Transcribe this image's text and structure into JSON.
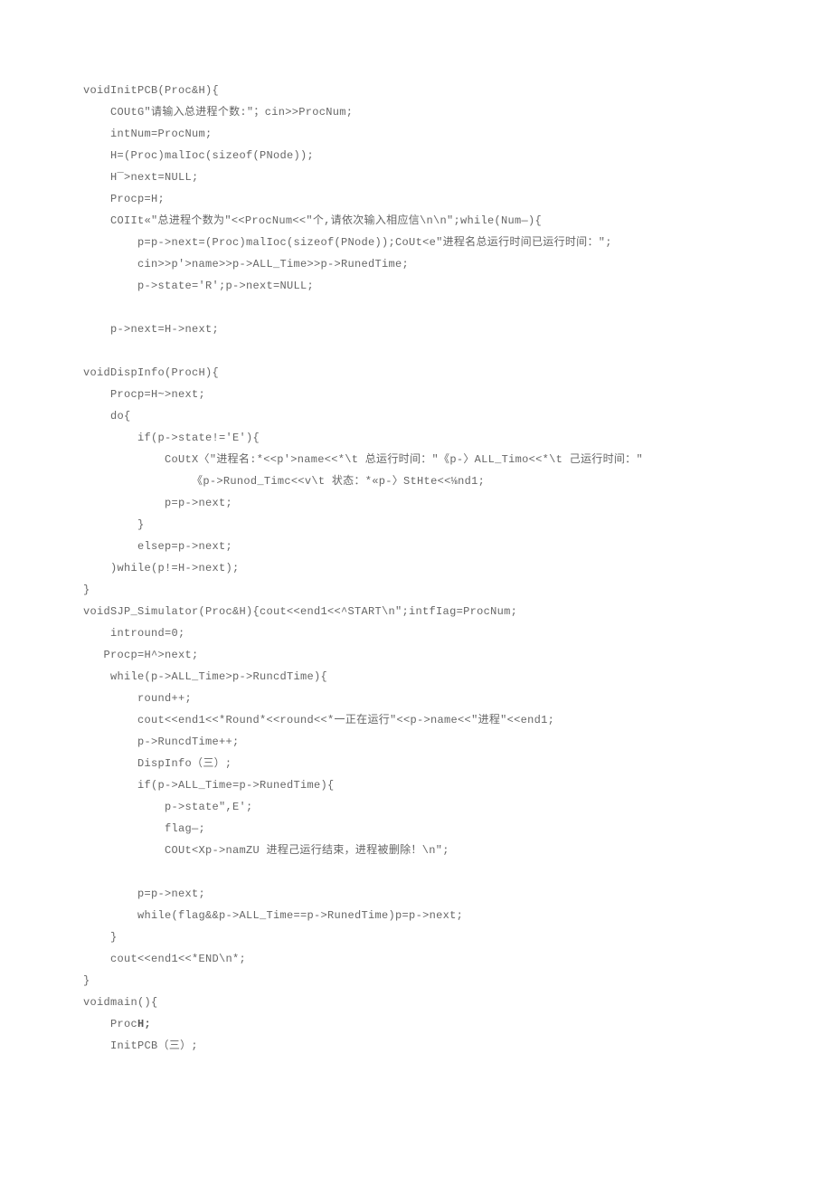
{
  "code": {
    "l1": "voidInitPCB(Proc&H){",
    "l2": "    COUtG″请输入总进程个数:″；cin>>ProcNum;",
    "l3": "    intNum=ProcNum;",
    "l4": "    H=(Proc)malIoc(sizeof(PNode));",
    "l5": "    H‾>next=NULL;",
    "l6": "    Procp=H;",
    "l7": "    COIIt«″总进程个数为″<<ProcNum<<″个,请依次输入相应信\\n\\n″;while(Num—){",
    "l8": "        p=p->next=(Proc)malIoc(sizeof(PNode));CoUt<e″进程名总运行时间已运行时间：″;",
    "l9": "        cin>>p'>name>>p->ALL_Time>>p->RunedTime;",
    "l10": "        p->state='R';p->next=NULL;",
    "l11": "",
    "l12": "    p->next=H->next;",
    "l13": "",
    "l14": "voidDispInfo(ProcH){",
    "l15": "    Procp=H~>next;",
    "l16": "    do{",
    "l17": "        if(p->state!='E'){",
    "l18": "            CoUtX〈″进程名:*<<p'>name<<*\\t 总运行时间：″《p-〉ALL_Timo<<*\\t 己运行时间：″",
    "l19": "                《p->Runod_Timc<<v\\t 状态：*«p-〉StHte<<⅛nd1;",
    "l20": "            p=p->next;",
    "l21": "        }",
    "l22": "        elsep=p->next;",
    "l23": "    )while(p!=H->next);",
    "l24": "}",
    "l25": "voidSJP_Simulator(Proc&H){cout<<end1<<^START\\n″;intfIag=ProcNum;",
    "l26": "    intround=0;",
    "l27": "   Procp=H^>next;",
    "l28": "    while(p->ALL_Time>p->RuncdTime){",
    "l29": "        round++;",
    "l30": "        cout<<end1<<*Round*<<round<<*一正在运行″<<p->name<<″进程″<<end1;",
    "l31": "        p->RuncdTime++;",
    "l32": "        DispInfo（三）;",
    "l33": "        if(p->ALL_Time=p->RunedTime){",
    "l34": "            p->state\",E';",
    "l35": "            flag—;",
    "l36": "            COUt<Xp->namZU 进程己运行结束，进程被删除！\\n″;",
    "l37": "",
    "l38": "        p=p->next;",
    "l39": "        while(flag&&p->ALL_Time==p->RunedTime)p=p->next;",
    "l40": "    }",
    "l41": "    cout<<end1<<*END\\n*;",
    "l42": "}",
    "l43": "voidmain(){",
    "l44a": "    Proc",
    "l44b": "H;",
    "l45": "    InitPCB（三）;"
  }
}
